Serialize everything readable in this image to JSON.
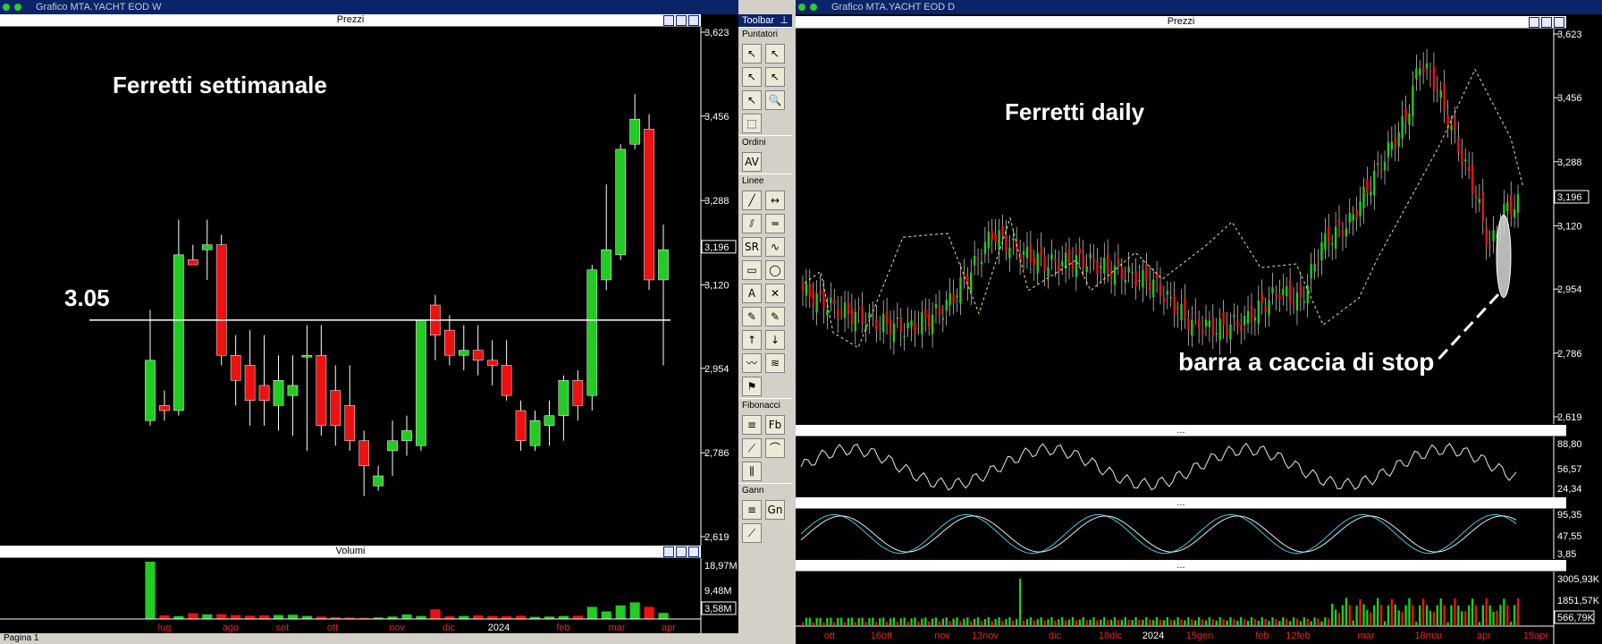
{
  "left_window": {
    "title": "Grafico MTA.YACHT EOD W",
    "price_pane_title": "Prezzi",
    "volume_pane_title": "Volumi"
  },
  "right_window": {
    "title": "Grafico MTA.YACHT EOD D",
    "price_pane_title": "Prezzi",
    "indicator_pane_title": "..."
  },
  "toolbar": {
    "title": "Toolbar",
    "sections": [
      {
        "label": "Puntatori",
        "rows": [
          [
            "↖",
            "↖"
          ],
          [
            "↖",
            "↖"
          ],
          [
            "↖",
            "🔍"
          ],
          [
            "⬚"
          ]
        ]
      },
      {
        "label": "Ordini",
        "rows": [
          [
            "AV"
          ]
        ]
      },
      {
        "label": "Linee",
        "rows": [
          [
            "╱",
            "↔"
          ],
          [
            "⫽",
            "═"
          ],
          [
            "SR",
            "∿"
          ],
          [
            "▭",
            "◯"
          ],
          [
            "A",
            "✕"
          ],
          [
            "✎",
            "✎"
          ],
          [
            "↑",
            "↓"
          ],
          [
            "〰",
            "≋"
          ],
          [
            "⚑"
          ]
        ]
      },
      {
        "label": "Fibonacci",
        "rows": [
          [
            "≡",
            "Fb"
          ],
          [
            "⟋",
            "⌒"
          ],
          [
            "⫼"
          ]
        ]
      },
      {
        "label": "Gann",
        "rows": [
          [
            "≡",
            "Gn"
          ],
          [
            "⟋"
          ]
        ]
      }
    ]
  },
  "status_bar": {
    "tab": "Pagina 1"
  },
  "colors": {
    "up": "#22cc22",
    "down": "#ee1111",
    "background": "#000000",
    "price_label": "#ffffff",
    "fib_line": "#e8e890",
    "stoch_k": "#3ac8e8",
    "stoch_d": "#e8e8e8"
  },
  "chart_data": [
    {
      "type": "candlestick",
      "title": "Ferretti settimanale",
      "annotation": "3.05",
      "horizontal_line": 3.05,
      "y_ticks": [
        "3,623",
        "3,456",
        "3,288",
        "3,120",
        "2,954",
        "2,786",
        "2,619"
      ],
      "ylim": [
        2.619,
        3.623
      ],
      "last_price_label": "3,196",
      "x_labels": [
        "lug",
        "ago",
        "set",
        "ott",
        "nov",
        "dic",
        "2024",
        "feb",
        "mar",
        "apr"
      ],
      "candles": [
        {
          "o": 2.85,
          "h": 3.07,
          "l": 2.84,
          "c": 2.97
        },
        {
          "o": 2.88,
          "h": 2.91,
          "l": 2.85,
          "c": 2.87
        },
        {
          "o": 2.87,
          "h": 3.25,
          "l": 2.86,
          "c": 3.18
        },
        {
          "o": 3.17,
          "h": 3.2,
          "l": 3.16,
          "c": 3.16
        },
        {
          "o": 3.19,
          "h": 3.25,
          "l": 3.13,
          "c": 3.2
        },
        {
          "o": 3.2,
          "h": 3.22,
          "l": 2.96,
          "c": 2.98
        },
        {
          "o": 2.98,
          "h": 3.02,
          "l": 2.88,
          "c": 2.93
        },
        {
          "o": 2.96,
          "h": 3.03,
          "l": 2.84,
          "c": 2.89
        },
        {
          "o": 2.92,
          "h": 3.02,
          "l": 2.84,
          "c": 2.89
        },
        {
          "o": 2.88,
          "h": 2.98,
          "l": 2.83,
          "c": 2.93
        },
        {
          "o": 2.9,
          "h": 2.98,
          "l": 2.82,
          "c": 2.92
        },
        {
          "o": 2.98,
          "h": 3.04,
          "l": 2.79,
          "c": 2.98
        },
        {
          "o": 2.98,
          "h": 3.04,
          "l": 2.82,
          "c": 2.84
        },
        {
          "o": 2.91,
          "h": 2.96,
          "l": 2.8,
          "c": 2.84
        },
        {
          "o": 2.88,
          "h": 2.96,
          "l": 2.79,
          "c": 2.81
        },
        {
          "o": 2.81,
          "h": 2.83,
          "l": 2.7,
          "c": 2.76
        },
        {
          "o": 2.72,
          "h": 2.76,
          "l": 2.71,
          "c": 2.74
        },
        {
          "o": 2.79,
          "h": 2.85,
          "l": 2.74,
          "c": 2.81
        },
        {
          "o": 2.81,
          "h": 2.86,
          "l": 2.78,
          "c": 2.83
        },
        {
          "o": 2.8,
          "h": 3.04,
          "l": 2.79,
          "c": 3.05
        },
        {
          "o": 3.08,
          "h": 3.1,
          "l": 2.97,
          "c": 3.02
        },
        {
          "o": 3.03,
          "h": 3.06,
          "l": 2.96,
          "c": 2.98
        },
        {
          "o": 2.98,
          "h": 3.04,
          "l": 2.95,
          "c": 2.99
        },
        {
          "o": 2.99,
          "h": 3.04,
          "l": 2.94,
          "c": 2.97
        },
        {
          "o": 2.97,
          "h": 3.01,
          "l": 2.92,
          "c": 2.96
        },
        {
          "o": 2.96,
          "h": 3.01,
          "l": 2.89,
          "c": 2.9
        },
        {
          "o": 2.87,
          "h": 2.89,
          "l": 2.79,
          "c": 2.81
        },
        {
          "o": 2.8,
          "h": 2.87,
          "l": 2.79,
          "c": 2.85
        },
        {
          "o": 2.84,
          "h": 2.89,
          "l": 2.8,
          "c": 2.86
        },
        {
          "o": 2.86,
          "h": 2.94,
          "l": 2.81,
          "c": 2.93
        },
        {
          "o": 2.93,
          "h": 2.95,
          "l": 2.85,
          "c": 2.88
        },
        {
          "o": 2.9,
          "h": 3.16,
          "l": 2.87,
          "c": 3.15
        },
        {
          "o": 3.13,
          "h": 3.32,
          "l": 3.11,
          "c": 3.19
        },
        {
          "o": 3.18,
          "h": 3.4,
          "l": 3.17,
          "c": 3.39
        },
        {
          "o": 3.4,
          "h": 3.5,
          "l": 3.39,
          "c": 3.45
        },
        {
          "o": 3.43,
          "h": 3.46,
          "l": 3.11,
          "c": 3.13
        },
        {
          "o": 3.13,
          "h": 3.24,
          "l": 2.96,
          "c": 3.19
        }
      ],
      "volumes_m": [
        18.97,
        1.2,
        0.9,
        1.9,
        1.5,
        1.6,
        1.3,
        1.1,
        1.2,
        1.3,
        1.4,
        1.0,
        0.8,
        0.6,
        0.5,
        0.4,
        0.5,
        0.8,
        1.5,
        1.0,
        3.2,
        0.9,
        1.0,
        1.2,
        1.0,
        0.9,
        1.1,
        0.7,
        0.8,
        1.0,
        1.1,
        4.0,
        2.5,
        4.5,
        5.5,
        4.0,
        2.0
      ],
      "volume_ticks": [
        "18,97M",
        "9,48M"
      ],
      "volume_last_label": "3,58M"
    },
    {
      "type": "candlestick",
      "title": "Ferretti daily",
      "annotation": "barra a caccia di stop",
      "y_ticks": [
        "3,623",
        "3,456",
        "3,288",
        "3,120",
        "2,954",
        "2,786",
        "2,619"
      ],
      "ylim": [
        2.619,
        3.623
      ],
      "last_price_label": "3,196",
      "x_labels": [
        "ott",
        "16ott",
        "nov",
        "13nov",
        "dic",
        "18dic",
        "2024",
        "15gen",
        "feb",
        "12feb",
        "mar",
        "18mar",
        "apr",
        "15apr"
      ],
      "indicator1_ticks": [
        "88,80",
        "56,57",
        "24,34"
      ],
      "indicator2_ticks": [
        "95,35",
        "47,55",
        "3,85"
      ],
      "volume_ticks": [
        "3005,93K",
        "1851,57K"
      ],
      "volume_last_label": "566,79K"
    }
  ]
}
